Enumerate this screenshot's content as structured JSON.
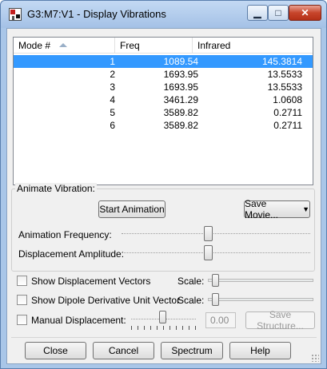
{
  "window": {
    "title": "G3:M7:V1 - Display Vibrations",
    "icon": "app-icon",
    "controls": {
      "minimize": "▁",
      "maximize": "□",
      "close": "✕"
    }
  },
  "table": {
    "columns": [
      "Mode #",
      "Freq",
      "Infrared"
    ],
    "sort_icon": "sort-ascending-icon",
    "rows": [
      {
        "mode": "1",
        "freq": "1089.54",
        "ir": "145.3814",
        "selected": true
      },
      {
        "mode": "2",
        "freq": "1693.95",
        "ir": "13.5533"
      },
      {
        "mode": "3",
        "freq": "1693.95",
        "ir": "13.5533"
      },
      {
        "mode": "4",
        "freq": "3461.29",
        "ir": "1.0608"
      },
      {
        "mode": "5",
        "freq": "3589.82",
        "ir": "0.2711"
      },
      {
        "mode": "6",
        "freq": "3589.82",
        "ir": "0.2711"
      }
    ]
  },
  "animate": {
    "group_label": "Animate Vibration:",
    "start_button": "Start Animation",
    "save_movie_button": "Save Movie...",
    "frequency_label": "Animation Frequency:",
    "frequency_level": 0.5,
    "amplitude_label": "Displacement Amplitude:",
    "amplitude_level": 0.5
  },
  "options": {
    "show_displacement_vectors": "Show Displacement Vectors",
    "show_dipole_vector": "Show Dipole Derivative Unit Vector",
    "manual_displacement": "Manual Displacement:",
    "scale_label": "Scale:",
    "manual_value": "0.00",
    "save_structure_button": "Save Structure..."
  },
  "footer": {
    "close_button": "Close",
    "cancel_button": "Cancel",
    "spectrum_button": "Spectrum",
    "help_button": "Help"
  }
}
